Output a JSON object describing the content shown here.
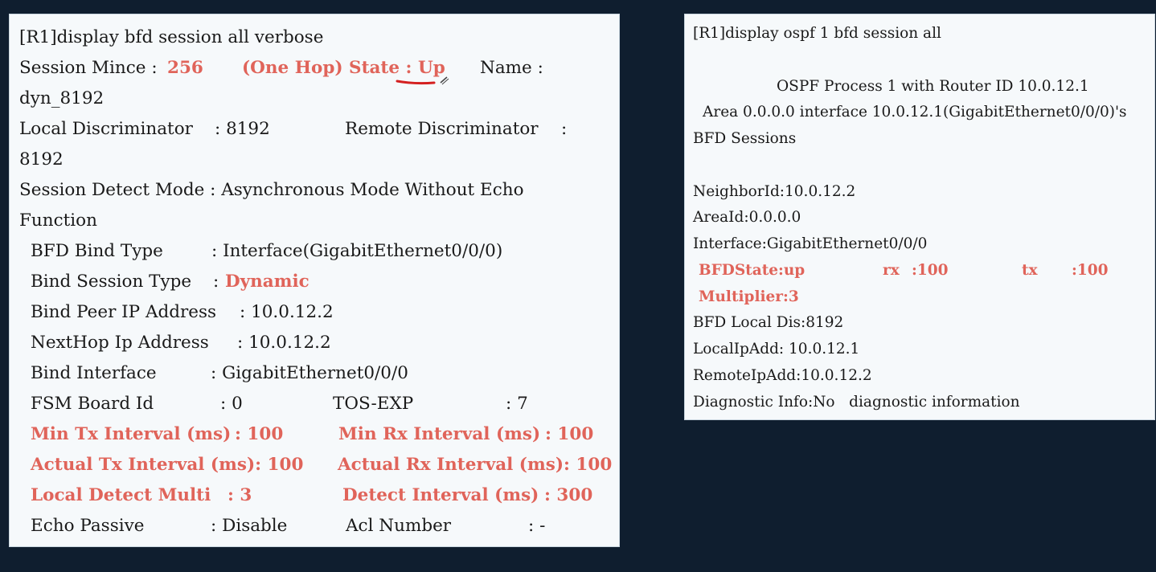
{
  "left": {
    "command": "[R1]display bfd session all verbose",
    "session_label": "Session Mince :",
    "session_value": "256",
    "state_text": "(One Hop) State : Up",
    "name_label": "Name :",
    "name_value": "dyn_8192",
    "local_disc_label": "Local Discriminator",
    "local_disc_value": ": 8192",
    "remote_disc_label": "Remote Discriminator",
    "remote_disc_colon": ":",
    "remote_disc_value": "8192",
    "detect_mode_line": "Session Detect Mode : Asynchronous Mode Without Echo",
    "detect_mode_cont": "Function",
    "bind_type_label": "BFD Bind Type",
    "bind_type_value": ": Interface(GigabitEthernet0/0/0)",
    "bind_session_label": "Bind Session Type",
    "bind_session_colon": ":",
    "bind_session_value": "Dynamic",
    "peer_ip_label": "Bind Peer IP Address",
    "peer_ip_value": ": 10.0.12.2",
    "nexthop_label": "NextHop Ip Address",
    "nexthop_value": ": 10.0.12.2",
    "bind_if_label": "Bind Interface",
    "bind_if_value": ": GigabitEthernet0/0/0",
    "fsm_label": "FSM Board Id",
    "fsm_value": ": 0",
    "tos_label": "TOS-EXP",
    "tos_value": ": 7",
    "min_tx_label": "Min Tx Interval (ms)",
    "min_tx_value": ": 100",
    "min_rx_label": "Min Rx Interval (ms)",
    "min_rx_value": ": 100",
    "act_tx_label": "Actual Tx Interval (ms): 100",
    "act_rx_label": "Actual Rx Interval (ms): 100",
    "ldm_label": "Local Detect Multi",
    "ldm_value": ": 3",
    "detect_int_label": "Detect Interval (ms)",
    "detect_int_value": ": 300",
    "echo_label": "Echo Passive",
    "echo_value": ": Disable",
    "acl_label": "Acl Number",
    "acl_value": ": -"
  },
  "right": {
    "command": "[R1]display ospf 1 bfd session all",
    "process_line": "OSPF Process 1 with Router ID 10.0.12.1",
    "area_line": "Area 0.0.0.0 interface 10.0.12.1(GigabitEthernet0/0/0)'s",
    "bfd_sessions": "BFD Sessions",
    "neighbor": "NeighborId:10.0.12.2",
    "area_id": "AreaId:0.0.0.0",
    "interface": "Interface:GigabitEthernet0/0/0",
    "bfd_state": "BFDState:up",
    "rx_label": "rx",
    "rx_value": ":100",
    "tx_label": "tx",
    "tx_value": ":100",
    "multiplier": "Multiplier:3",
    "local_dis": "BFD Local Dis:8192",
    "local_ip": "LocalIpAdd: 10.0.12.1",
    "remote_ip": "RemoteIpAdd:10.0.12.2",
    "diag": "Diagnostic Info:No   diagnostic information"
  },
  "colors": {
    "background": "#0f1e2f",
    "panel": "#f6f9fb",
    "highlight": "#e0645a",
    "annotation": "#d42020"
  }
}
